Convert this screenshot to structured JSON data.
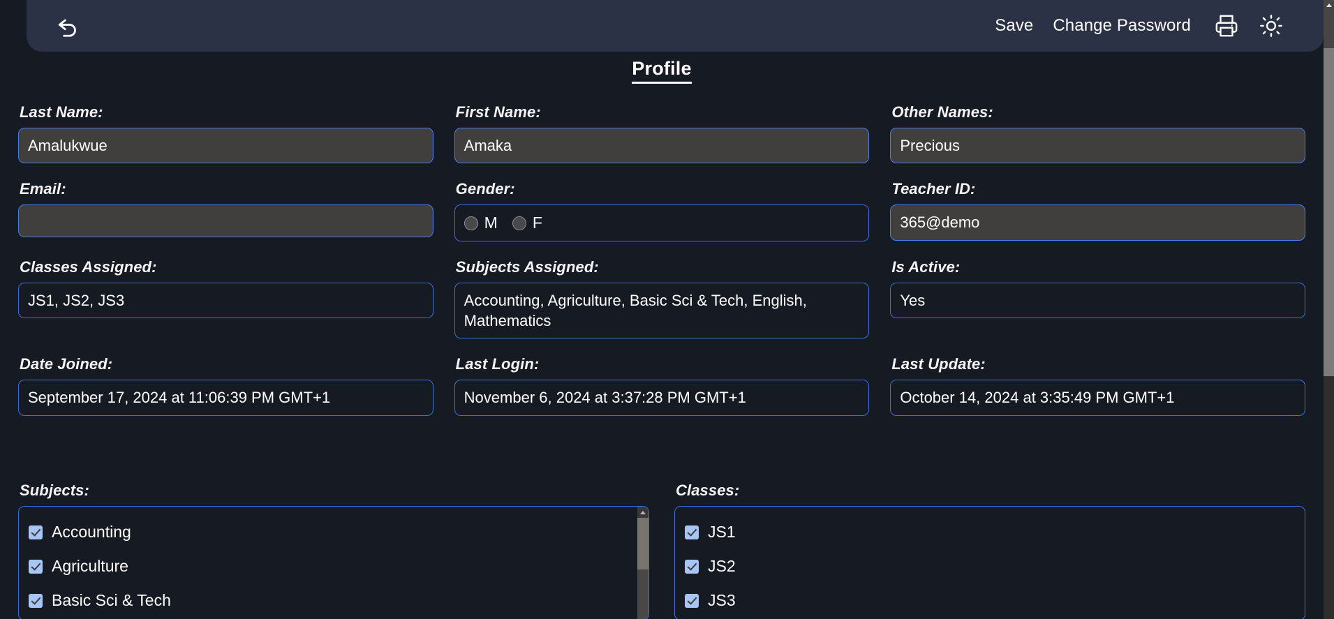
{
  "header": {
    "back_icon": "back-arrow-icon",
    "save_label": "Save",
    "change_password_label": "Change Password",
    "print_icon": "printer-icon",
    "theme_icon": "sun-icon"
  },
  "page_title": "Profile",
  "form": {
    "last_name": {
      "label": "Last Name:",
      "value": "Amalukwue"
    },
    "first_name": {
      "label": "First Name:",
      "value": "Amaka"
    },
    "other_names": {
      "label": "Other Names:",
      "value": "Precious"
    },
    "email": {
      "label": "Email:",
      "value": ""
    },
    "gender": {
      "label": "Gender:",
      "options": [
        {
          "label": "M",
          "selected": false
        },
        {
          "label": "F",
          "selected": false
        }
      ]
    },
    "teacher_id": {
      "label": "Teacher ID:",
      "value": "365@demo"
    },
    "classes_assigned": {
      "label": "Classes Assigned:",
      "value": "JS1, JS2, JS3"
    },
    "subjects_assigned": {
      "label": "Subjects Assigned:",
      "value": "Accounting, Agriculture, Basic Sci & Tech, English, Mathematics"
    },
    "is_active": {
      "label": "Is Active:",
      "value": "Yes"
    },
    "date_joined": {
      "label": "Date Joined:",
      "value": "September 17, 2024 at 11:06:39 PM GMT+1"
    },
    "last_login": {
      "label": "Last Login:",
      "value": "November 6, 2024 at 3:37:28 PM GMT+1"
    },
    "last_update": {
      "label": "Last Update:",
      "value": "October 14, 2024 at 3:35:49 PM GMT+1"
    }
  },
  "subjects_list": {
    "label": "Subjects:",
    "items": [
      {
        "label": "Accounting",
        "checked": true
      },
      {
        "label": "Agriculture",
        "checked": true
      },
      {
        "label": "Basic Sci & Tech",
        "checked": true
      }
    ]
  },
  "classes_list": {
    "label": "Classes:",
    "items": [
      {
        "label": "JS1",
        "checked": true
      },
      {
        "label": "JS2",
        "checked": true
      },
      {
        "label": "JS3",
        "checked": true
      }
    ]
  },
  "colors": {
    "background": "#161a23",
    "header_bar": "#2b3245",
    "field_border": "#3b6fe0",
    "field_filled_bg": "#413f3e",
    "checkbox": "#a8c6f5",
    "text": "#ffffff"
  }
}
